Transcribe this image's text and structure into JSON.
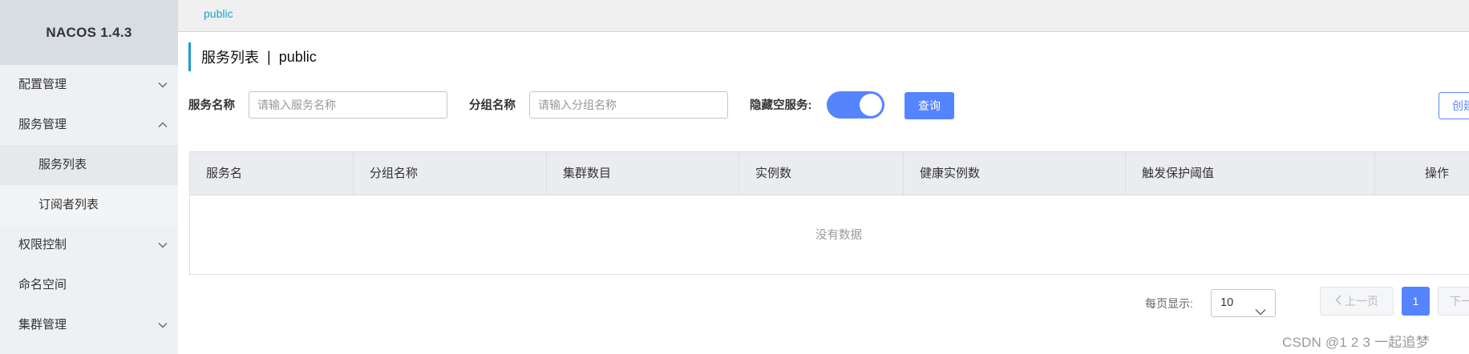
{
  "sidebar": {
    "logo": "NACOS 1.4.3",
    "items": [
      {
        "label": "配置管理"
      },
      {
        "label": "服务管理"
      },
      {
        "label": "服务列表"
      },
      {
        "label": "订阅者列表"
      },
      {
        "label": "权限控制"
      },
      {
        "label": "命名空间"
      },
      {
        "label": "集群管理"
      }
    ]
  },
  "topbar": {
    "namespace": "public"
  },
  "title": {
    "main": "服务列表",
    "separator": "|",
    "namespace": "public"
  },
  "filters": {
    "service_name_label": "服务名称",
    "service_name_placeholder": "请输入服务名称",
    "group_name_label": "分组名称",
    "group_name_placeholder": "请输入分组名称",
    "hide_empty_label": "隐藏空服务:",
    "hide_empty_on": true,
    "query_button": "查询",
    "create_button": "创建服务"
  },
  "table": {
    "columns": [
      "服务名",
      "分组名称",
      "集群数目",
      "实例数",
      "健康实例数",
      "触发保护阈值",
      "操作"
    ],
    "rows": [],
    "empty_text": "没有数据"
  },
  "pagination": {
    "page_size_label": "每页显示:",
    "page_size": "10",
    "prev": "上一页",
    "current_page": "1",
    "next": "下一页"
  },
  "watermark": "CSDN @1 2 3 一起追梦",
  "colors": {
    "accent": "#5584ff",
    "breadcrumb": "#14a6c9",
    "title_bar": "#1c9bd1",
    "sidebar_bg": "#eef0f3"
  }
}
